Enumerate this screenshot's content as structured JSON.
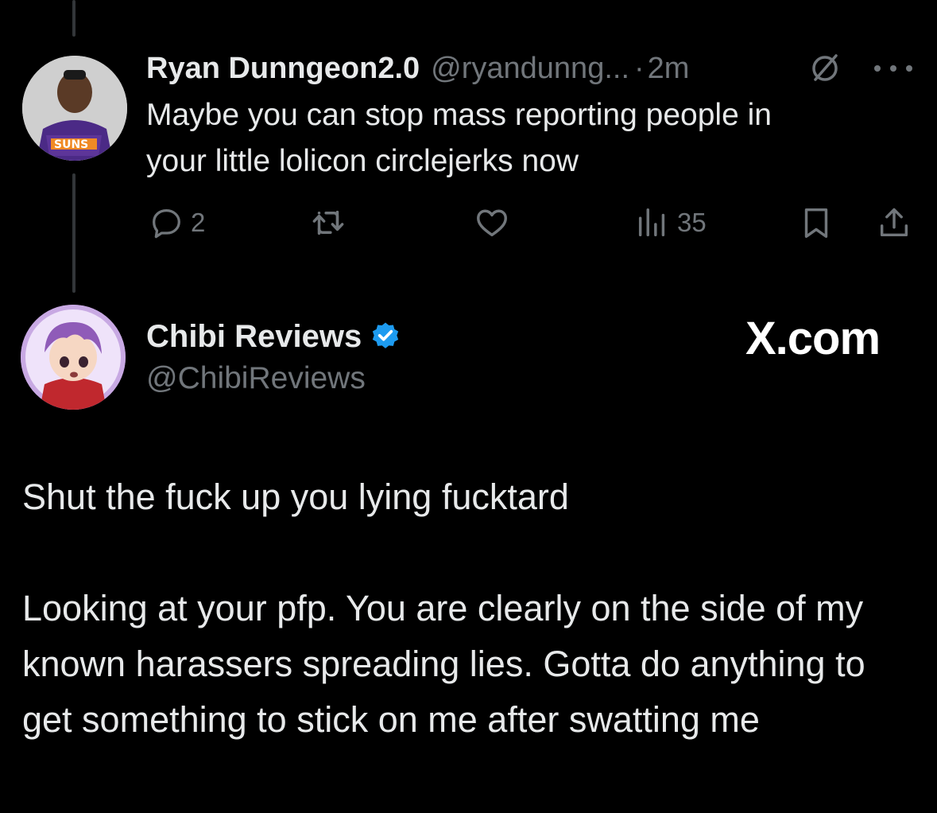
{
  "reply_tweet": {
    "display_name": "Ryan Dunngeon2.0",
    "handle": "@ryandunng...",
    "separator": "·",
    "time": "2m",
    "text": "Maybe you can stop mass reporting people in\nyour little lolicon circlejerks now",
    "actions": {
      "reply_count": "2",
      "retweet_count": "",
      "like_count": "",
      "views_count": "35"
    },
    "icons": [
      "grok-icon",
      "more-icon",
      "reply-icon",
      "retweet-icon",
      "like-icon",
      "views-icon",
      "bookmark-icon",
      "share-icon"
    ]
  },
  "quoted_response": {
    "display_name": "Chibi Reviews",
    "handle": "@ChibiReviews",
    "verified": true,
    "verified_color": "#1d9bf0",
    "brand": "X.com",
    "paragraphs": [
      "Shut the fuck up you lying fucktard",
      "Looking at your pfp. You are clearly on the side of my known harassers spreading lies. Gotta do anything to get something to stick on me after swatting me"
    ]
  },
  "colors": {
    "background": "#000000",
    "text_primary": "#e7e9ea",
    "text_secondary": "#71767b",
    "thread_line": "#333639"
  }
}
